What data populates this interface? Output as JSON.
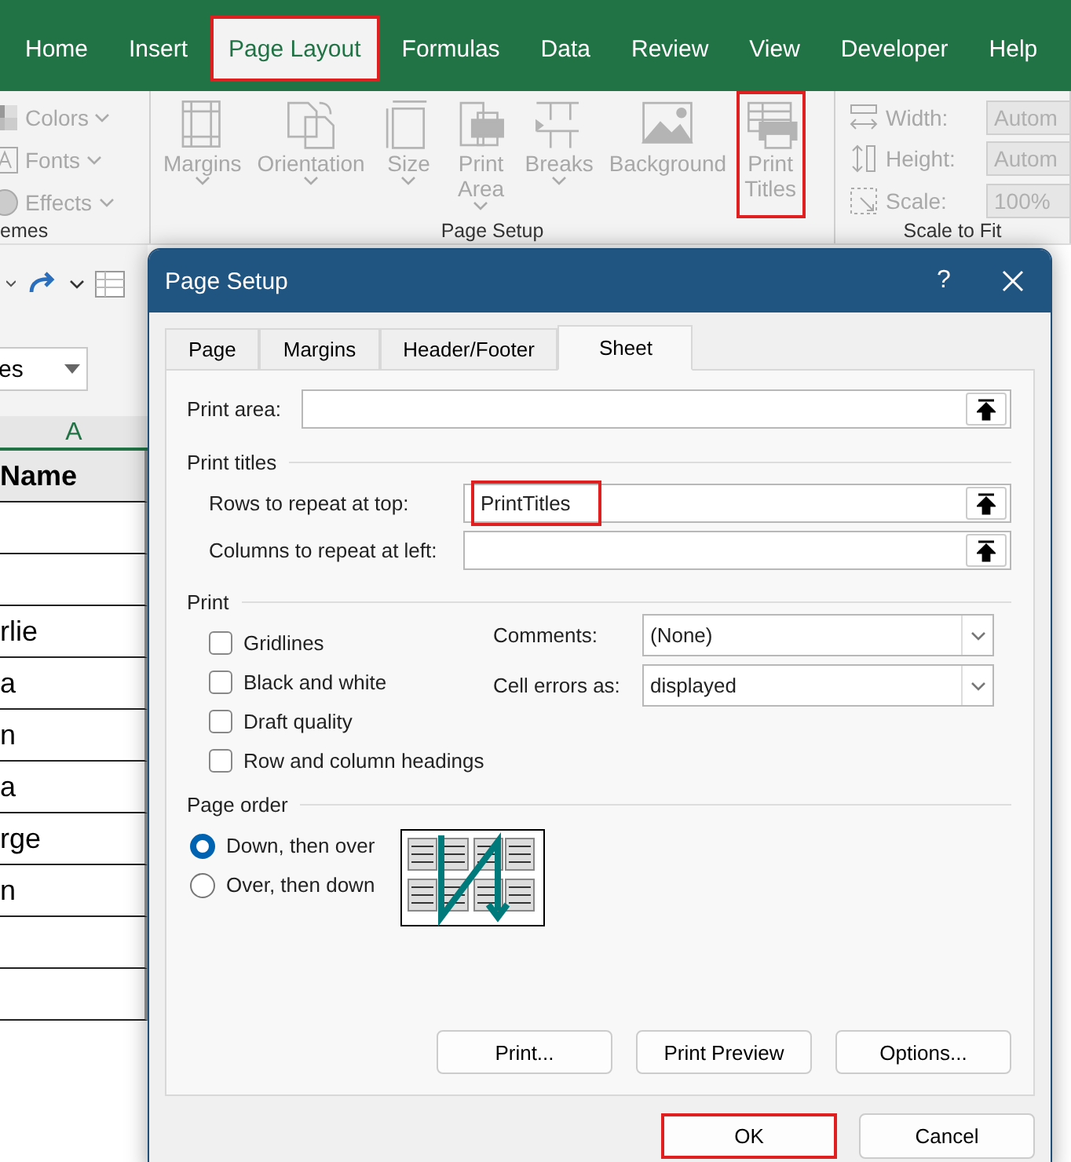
{
  "ribbon_tabs": [
    {
      "label": "Home",
      "selected": false,
      "highlighted": false
    },
    {
      "label": "Insert",
      "selected": false,
      "highlighted": false
    },
    {
      "label": "Page Layout",
      "selected": true,
      "highlighted": true
    },
    {
      "label": "Formulas",
      "selected": false,
      "highlighted": false
    },
    {
      "label": "Data",
      "selected": false,
      "highlighted": false
    },
    {
      "label": "Review",
      "selected": false,
      "highlighted": false
    },
    {
      "label": "View",
      "selected": false,
      "highlighted": false
    },
    {
      "label": "Developer",
      "selected": false,
      "highlighted": false
    },
    {
      "label": "Help",
      "selected": false,
      "highlighted": false
    }
  ],
  "ribbon": {
    "disabled": true,
    "groups": [
      {
        "label": "emes",
        "items": [
          {
            "kind": "small",
            "label": "Colors"
          },
          {
            "kind": "small",
            "label": "Fonts"
          },
          {
            "kind": "small",
            "label": "Effects"
          }
        ]
      },
      {
        "label": "Page Setup",
        "items": [
          {
            "kind": "large",
            "label": "Margins",
            "highlighted": false
          },
          {
            "kind": "large",
            "label": "Orientation",
            "highlighted": false
          },
          {
            "kind": "large",
            "label": "Size",
            "highlighted": false
          },
          {
            "kind": "large",
            "label": "Print\nArea",
            "highlighted": false
          },
          {
            "kind": "large",
            "label": "Breaks",
            "highlighted": false
          },
          {
            "kind": "large",
            "label": "Background",
            "highlighted": false
          },
          {
            "kind": "large",
            "label": "Print\nTitles",
            "highlighted": true
          }
        ]
      },
      {
        "label": "Scale to Fit",
        "items": [
          {
            "kind": "field",
            "label": "Width:",
            "value": "Autom"
          },
          {
            "kind": "field",
            "label": "Height:",
            "value": "Autom"
          },
          {
            "kind": "field",
            "label": "Scale:",
            "value": "100%"
          }
        ]
      }
    ]
  },
  "name_box": {
    "value": "es"
  },
  "sheet": {
    "column": "A",
    "header": "Name",
    "cells": [
      "",
      "",
      "rlie",
      "a",
      "n",
      "a",
      "rge",
      "n",
      "",
      ""
    ]
  },
  "dialog": {
    "title": "Page Setup",
    "help": "?",
    "tabs": [
      {
        "label": "Page",
        "selected": false
      },
      {
        "label": "Margins",
        "selected": false
      },
      {
        "label": "Header/Footer",
        "selected": false
      },
      {
        "label": "Sheet",
        "selected": true
      }
    ],
    "print_area": {
      "label": "Print area:"
    },
    "print_titles": {
      "title": "Print titles",
      "fields": [
        {
          "label": "Rows to repeat at top:",
          "value": "PrintTitles",
          "highlighted": true
        },
        {
          "label": "Columns to repeat at left:",
          "highlighted": false
        }
      ]
    },
    "print": {
      "title": "Print",
      "checkboxes": [
        {
          "label": "Gridlines",
          "checked": false
        },
        {
          "label": "Black and white",
          "checked": false
        },
        {
          "label": "Draft quality",
          "checked": false
        },
        {
          "label": "Row and column headings",
          "checked": false
        }
      ],
      "dropdowns": [
        {
          "label": "Comments:",
          "value": "(None)"
        },
        {
          "label": "Cell errors as:",
          "value": "displayed"
        }
      ]
    },
    "page_order": {
      "title": "Page order",
      "options": [
        {
          "label": "Down, then over",
          "selected": true
        },
        {
          "label": "Over, then down",
          "selected": false
        }
      ]
    },
    "panel_buttons": [
      "Print...",
      "Print Preview",
      "Options..."
    ],
    "buttons": [
      {
        "label": "OK",
        "highlighted": true
      },
      {
        "label": "Cancel",
        "highlighted": false
      }
    ]
  }
}
